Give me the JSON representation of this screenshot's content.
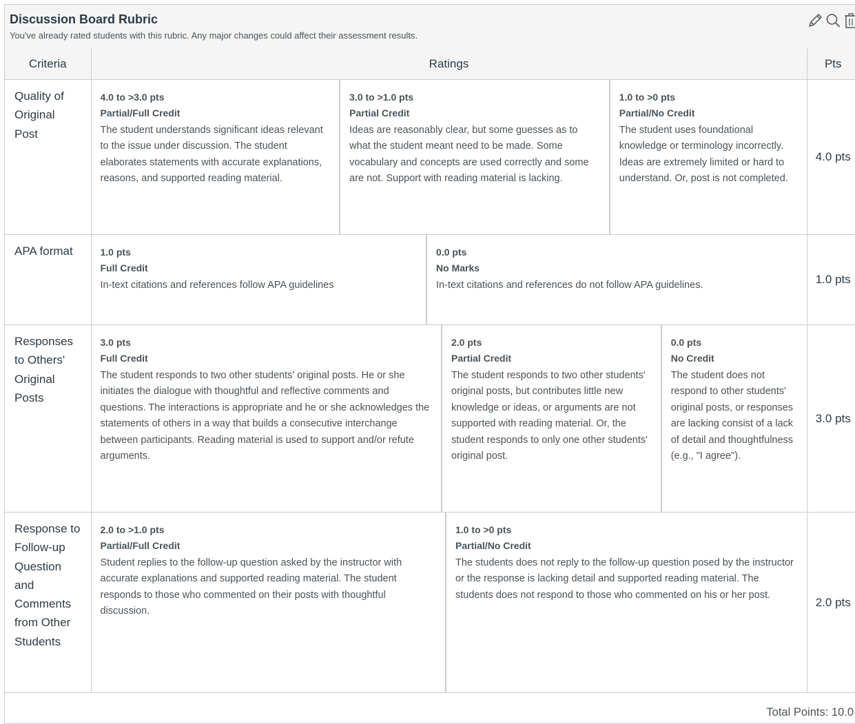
{
  "rubric": {
    "title": "Discussion Board Rubric",
    "warning": "You've already rated students with this rubric. Any major changes could affect their assessment results.",
    "icons": [
      "edit-icon",
      "search-icon",
      "delete-icon"
    ],
    "columns": {
      "criteria": "Criteria",
      "ratings": "Ratings",
      "points": "Pts"
    },
    "criteria": [
      {
        "name": "Quality of Original Post",
        "points": "4.0 pts",
        "ratings": [
          {
            "pts": "4.0 to >3.0 pts",
            "title": "Partial/Full Credit",
            "desc": "The student understands significant ideas relevant to the issue under discussion. The student elaborates statements with accurate explanations, reasons, and supported reading material."
          },
          {
            "pts": "3.0 to >1.0 pts",
            "title": "Partial Credit",
            "desc": "Ideas are reasonably clear, but some guesses as to what the student meant need to be made. Some vocabulary and concepts are used correctly and some are not. Support with reading material is lacking."
          },
          {
            "pts": "1.0 to >0 pts",
            "title": "Partial/No Credit",
            "desc": "The student uses foundational knowledge or terminology incorrectly. Ideas are extremely limited or hard to understand. Or, post is not completed."
          }
        ]
      },
      {
        "name": "APA format",
        "points": "1.0 pts",
        "ratings": [
          {
            "pts": "1.0 pts",
            "title": "Full Credit",
            "desc": "In-text citations and references follow APA guidelines"
          },
          {
            "pts": "0.0 pts",
            "title": "No Marks",
            "desc": "In-text citations and references do not follow APA guidelines."
          }
        ]
      },
      {
        "name": "Responses to Others' Original Posts",
        "points": "3.0 pts",
        "ratings": [
          {
            "pts": "3.0 pts",
            "title": "Full Credit",
            "desc": "The student responds to two other students' original posts. He or she initiates the dialogue with thoughtful and reflective comments and questions. The interactions is appropriate and he or she acknowledges the statements of others in a way that builds a consecutive interchange between participants. Reading material is used to support and/or refute arguments."
          },
          {
            "pts": "2.0 pts",
            "title": "Partial Credit",
            "desc": "The student responds to two other students' original posts, but contributes little new knowledge or ideas, or arguments are not supported with reading material. Or, the student responds to only one other students' original post."
          },
          {
            "pts": "0.0 pts",
            "title": "No Credit",
            "desc": "The student does not respond to other students' original posts, or responses are lacking consist of a lack of detail and thoughtfulness (e.g., \"I agree\")."
          }
        ]
      },
      {
        "name": "Response to Follow-up Question and Comments from Other Students",
        "points": "2.0 pts",
        "ratings": [
          {
            "pts": "2.0 to >1.0 pts",
            "title": "Partial/Full Credit",
            "desc": "Student replies to the follow-up question asked by the instructor with accurate explanations and supported reading material. The student responds to those who commented on their posts with thoughtful discussion."
          },
          {
            "pts": "1.0 to >0 pts",
            "title": "Partial/No Credit",
            "desc": "The students does not reply to the follow-up question posed by the instructor or the response is lacking detail and supported reading material. The students does not respond to those who commented on his or her post."
          }
        ]
      }
    ],
    "total": "Total Points: 10.0"
  }
}
